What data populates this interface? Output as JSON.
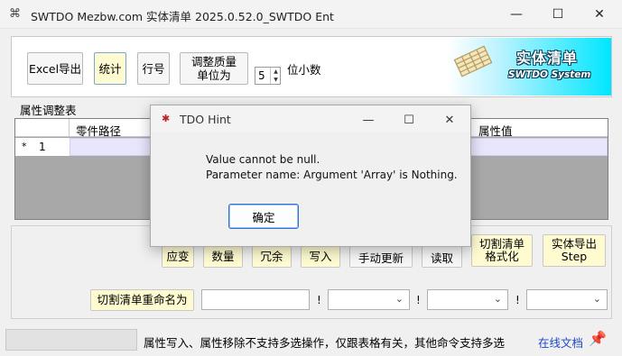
{
  "window": {
    "title": "SWTDO Mezbw.com 实体清单  2025.0.52.0_SWTDO Ent",
    "minimize": "—",
    "maximize": "☐",
    "close": "✕",
    "app_icon": "⌘"
  },
  "toolbar": {
    "excel_export": "Excel导出",
    "stats": "统计",
    "row_no": "行号",
    "adjust_mass_line1": "调整质量",
    "adjust_mass_line2": "单位为",
    "decimal_value": "5",
    "decimal_label": "位小数",
    "spin_up": "▲",
    "spin_down": "▼"
  },
  "banner": {
    "title": "实体清单",
    "subtitle": "SWTDO System"
  },
  "grid": {
    "group_label": "属性调整表",
    "columns": [
      "零件路径",
      "属性值"
    ],
    "row_marker": "*",
    "row_number": "1"
  },
  "actions": {
    "hidden_left": "应变",
    "count": "数量",
    "redundant": "冗余",
    "write": "写入",
    "manual_update": "手动更新",
    "read": "读取",
    "cut_format_line1": "切割清单",
    "cut_format_line2": "格式化",
    "entity_export_line1": "实体导出",
    "entity_export_line2": "Step"
  },
  "rename": {
    "button": "切割清单重命名为",
    "input_value": "",
    "sep": "!",
    "combo1": "",
    "combo2": "",
    "combo3": ""
  },
  "status": {
    "text": "属性写入、属性移除不支持多选操作，仅跟表格有关，其他命令支持多选",
    "link": "在线文档",
    "pin_icon": "📌"
  },
  "dialog": {
    "title": "TDO Hint",
    "line1": "Value cannot be null.",
    "line2": "Parameter name: Argument 'Array' is Nothing.",
    "ok": "确定",
    "minimize": "—",
    "maximize": "☐",
    "close": "✕",
    "icon": "✱"
  },
  "colors": {
    "highlight_button": "#fffbd0",
    "selected_cell": "#e8e6fb",
    "banner_cyan": "#00e6ff",
    "link": "#1d47c8"
  }
}
